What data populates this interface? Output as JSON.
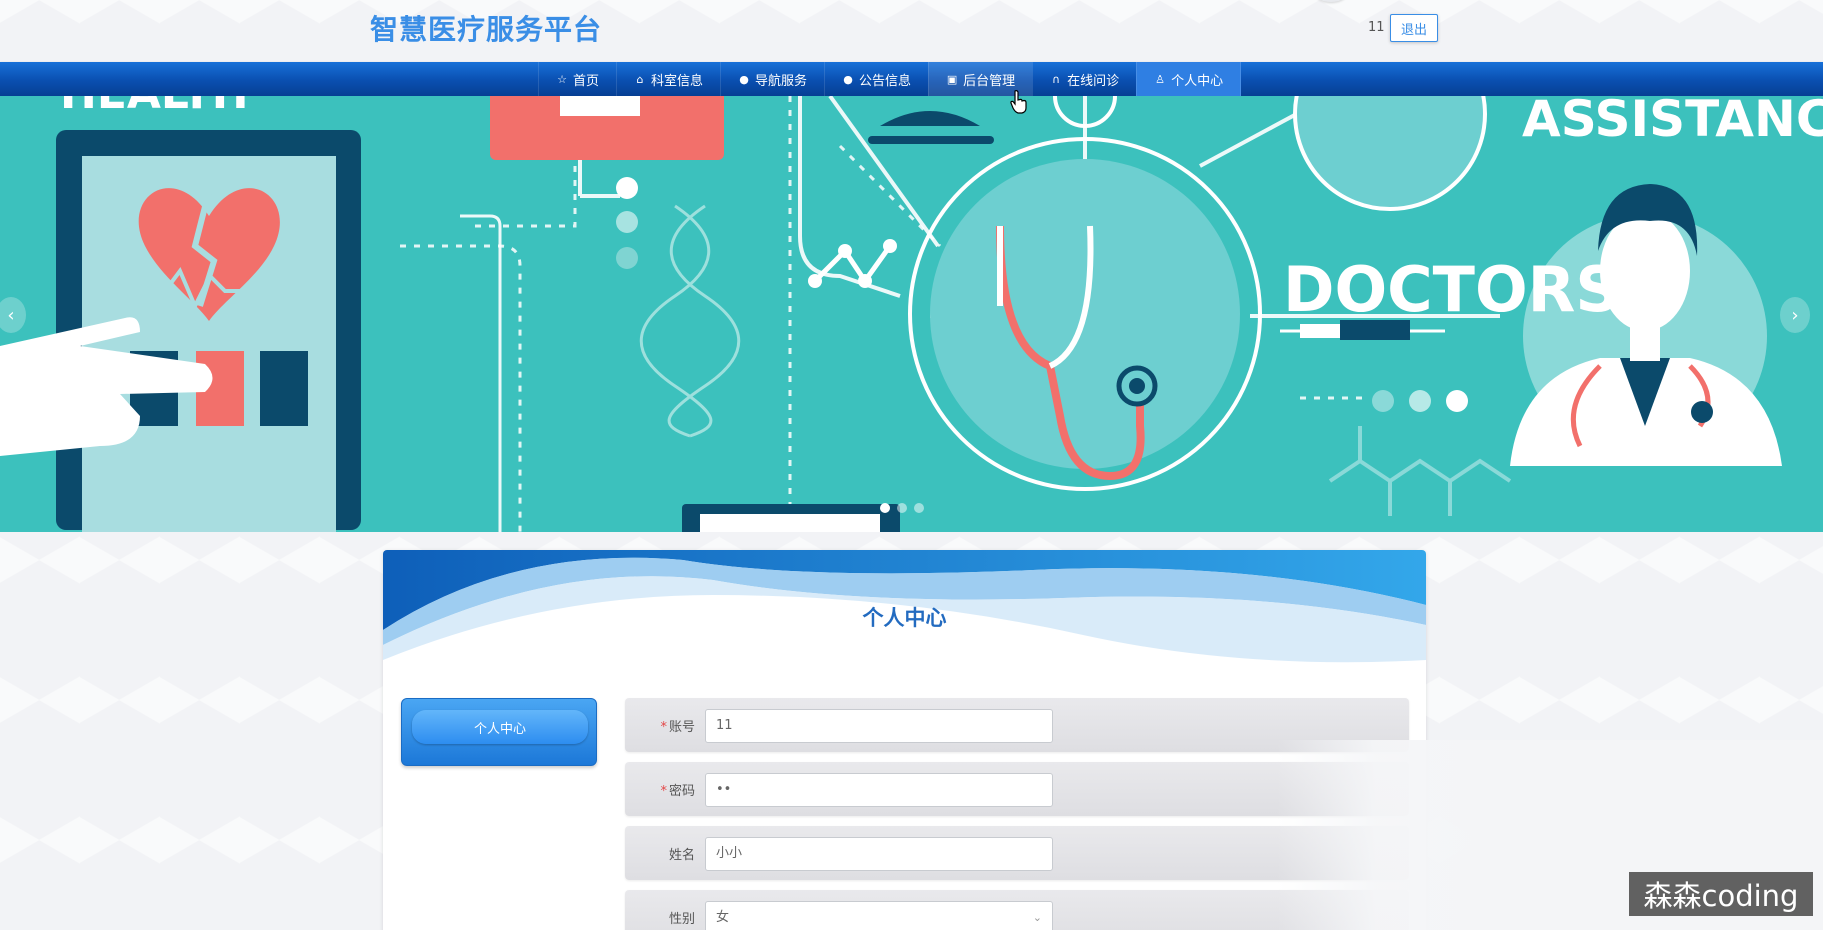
{
  "header": {
    "site_title": "智慧医疗服务平台",
    "username": "11",
    "logout_label": "退出"
  },
  "nav": {
    "items": [
      {
        "label": "首页",
        "icon": "star-icon"
      },
      {
        "label": "科室信息",
        "icon": "home-icon"
      },
      {
        "label": "导航服务",
        "icon": "info-icon"
      },
      {
        "label": "公告信息",
        "icon": "info-icon"
      },
      {
        "label": "后台管理",
        "icon": "dashboard-icon"
      },
      {
        "label": "在线问诊",
        "icon": "headset-icon"
      },
      {
        "label": "个人中心",
        "icon": "user-icon"
      }
    ],
    "active_index": 6,
    "hover_index": 4
  },
  "banner": {
    "texts": [
      "ASSISTANCE",
      "DOCTORS"
    ],
    "slide_count": 3,
    "current_slide": 1
  },
  "page": {
    "title": "个人中心",
    "side_menu_label": "个人中心"
  },
  "form": {
    "fields": [
      {
        "label": "账号",
        "required": true,
        "value": "11"
      },
      {
        "label": "密码",
        "required": true,
        "value": "••"
      },
      {
        "label": "姓名",
        "required": false,
        "value": "小小"
      },
      {
        "label": "性别",
        "required": false,
        "value": "女",
        "type": "select"
      }
    ]
  },
  "watermark": "森森coding",
  "colors": {
    "accent": "#3a8ee6",
    "nav": "#0a4fb0",
    "banner_teal": "#3cc1bd",
    "title_blue": "#236bc0",
    "required": "#e34545"
  }
}
